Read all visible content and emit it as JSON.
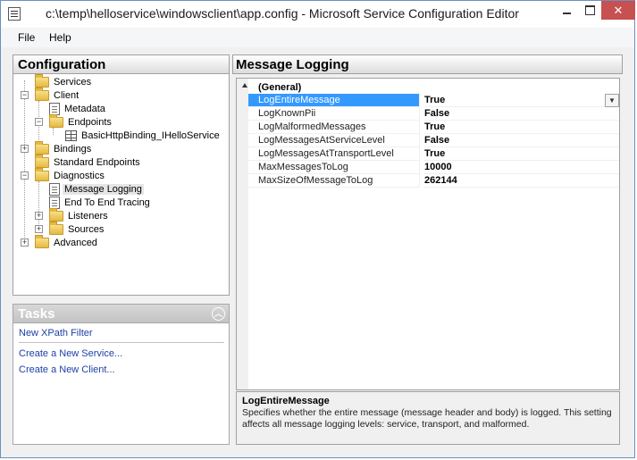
{
  "window": {
    "title": "c:\\temp\\helloservice\\windowsclient\\app.config - Microsoft Service Configuration Editor",
    "close_glyph": "✕"
  },
  "menu": {
    "file": "File",
    "help": "Help"
  },
  "configuration": {
    "header": "Configuration",
    "tree": {
      "services": "Services",
      "client": "Client",
      "metadata": "Metadata",
      "endpoints": "Endpoints",
      "binding": "BasicHttpBinding_IHelloService",
      "bindings": "Bindings",
      "standard_endpoints": "Standard Endpoints",
      "diagnostics": "Diagnostics",
      "message_logging": "Message Logging",
      "end_to_end": "End To End Tracing",
      "listeners": "Listeners",
      "sources": "Sources",
      "advanced": "Advanced"
    }
  },
  "tasks": {
    "header": "Tasks",
    "links": [
      "New XPath Filter",
      "Create a New Service...",
      "Create a New Client..."
    ]
  },
  "message_logging": {
    "header": "Message Logging",
    "category": "(General)",
    "properties": [
      {
        "name": "LogEntireMessage",
        "value": "True"
      },
      {
        "name": "LogKnownPii",
        "value": "False"
      },
      {
        "name": "LogMalformedMessages",
        "value": "True"
      },
      {
        "name": "LogMessagesAtServiceLevel",
        "value": "False"
      },
      {
        "name": "LogMessagesAtTransportLevel",
        "value": "True"
      },
      {
        "name": "MaxMessagesToLog",
        "value": "10000"
      },
      {
        "name": "MaxSizeOfMessageToLog",
        "value": "262144"
      }
    ],
    "description": {
      "title": "LogEntireMessage",
      "text": "Specifies whether the entire message (message header and body) is logged. This setting affects all message logging levels: service, transport, and malformed."
    }
  }
}
